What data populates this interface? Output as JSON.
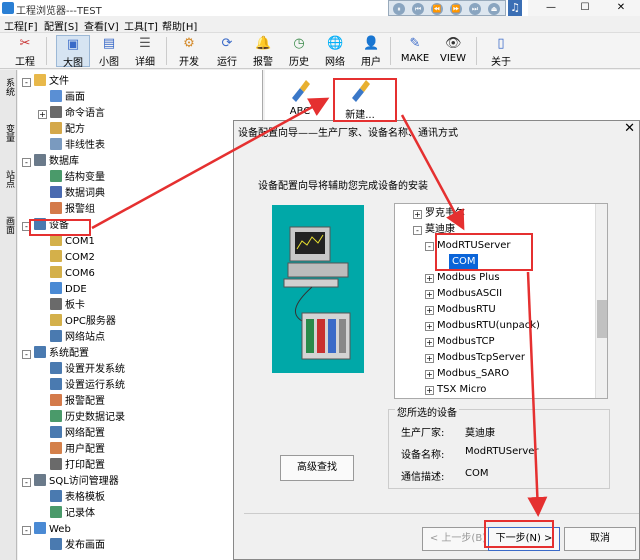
{
  "window": {
    "title": "工程浏览器---TEST",
    "controls": [
      "—",
      "☐",
      "✕"
    ]
  },
  "media": {
    "buttons": [
      "⏸",
      "⏮",
      "⏪",
      "⏩",
      "⏭",
      "⏏"
    ]
  },
  "menu": [
    "工程[F]",
    "配置[S]",
    "查看[V]",
    "工具[T]",
    "帮助[H]"
  ],
  "toolbar": [
    {
      "label": "工程",
      "icon": "wrench-icon",
      "glyph": "✂"
    },
    {
      "label": "大图",
      "icon": "large-icons-icon",
      "glyph": "▣"
    },
    {
      "label": "小图",
      "icon": "small-icons-icon",
      "glyph": "▤"
    },
    {
      "label": "详细",
      "icon": "details-icon",
      "glyph": "☰"
    },
    {
      "label": "开发",
      "icon": "develop-icon",
      "glyph": "⚙"
    },
    {
      "label": "运行",
      "icon": "run-icon",
      "glyph": "⟳"
    },
    {
      "label": "报警",
      "icon": "alarm-icon",
      "glyph": "🔔"
    },
    {
      "label": "历史",
      "icon": "history-icon",
      "glyph": "◷"
    },
    {
      "label": "网络",
      "icon": "network-icon",
      "glyph": "🌐"
    },
    {
      "label": "用户",
      "icon": "user-icon",
      "glyph": "👤"
    },
    {
      "label": "MAKE",
      "icon": "make-icon",
      "glyph": "✎"
    },
    {
      "label": "VIEW",
      "icon": "view-icon",
      "glyph": "👁"
    },
    {
      "label": "关于",
      "icon": "about-icon",
      "glyph": "▯"
    }
  ],
  "sidebar_tabs": [
    "系统",
    "变量",
    "站点",
    "画面"
  ],
  "tree": [
    {
      "label": "文件",
      "level": 0,
      "exp": "-",
      "color": "#e8b84a"
    },
    {
      "label": "画面",
      "level": 1,
      "color": "#5a8fd4"
    },
    {
      "label": "命令语言",
      "level": 1,
      "exp": "+",
      "color": "#6a6a6a"
    },
    {
      "label": "配方",
      "level": 1,
      "color": "#d4a84a"
    },
    {
      "label": "非线性表",
      "level": 1,
      "color": "#7a9abf"
    },
    {
      "label": "数据库",
      "level": 0,
      "exp": "-",
      "color": "#6a7a8a"
    },
    {
      "label": "结构变量",
      "level": 1,
      "color": "#4a9a6a"
    },
    {
      "label": "数据词典",
      "level": 1,
      "color": "#4a6ab0"
    },
    {
      "label": "报警组",
      "level": 1,
      "color": "#d47a4a"
    },
    {
      "label": "设备",
      "level": 0,
      "exp": "-",
      "color": "#4a7ab0"
    },
    {
      "label": "COM1",
      "level": 1,
      "color": "#d4b04a"
    },
    {
      "label": "COM2",
      "level": 1,
      "color": "#d4b04a"
    },
    {
      "label": "COM6",
      "level": 1,
      "color": "#d4b04a"
    },
    {
      "label": "DDE",
      "level": 1,
      "color": "#4a8ad4"
    },
    {
      "label": "板卡",
      "level": 1,
      "color": "#6a6a6a"
    },
    {
      "label": "OPC服务器",
      "level": 1,
      "color": "#d4b04a"
    },
    {
      "label": "网络站点",
      "level": 1,
      "color": "#4a7ab0"
    },
    {
      "label": "系统配置",
      "level": 0,
      "exp": "-",
      "color": "#4a7ab0"
    },
    {
      "label": "设置开发系统",
      "level": 1,
      "color": "#4a7ab0"
    },
    {
      "label": "设置运行系统",
      "level": 1,
      "color": "#4a7ab0"
    },
    {
      "label": "报警配置",
      "level": 1,
      "color": "#d47a4a"
    },
    {
      "label": "历史数据记录",
      "level": 1,
      "color": "#4a9a6a"
    },
    {
      "label": "网络配置",
      "level": 1,
      "color": "#4a7ab0"
    },
    {
      "label": "用户配置",
      "level": 1,
      "color": "#d4804a"
    },
    {
      "label": "打印配置",
      "level": 1,
      "color": "#6a6a6a"
    },
    {
      "label": "SQL访问管理器",
      "level": 0,
      "exp": "-",
      "color": "#6a7a8a"
    },
    {
      "label": "表格模板",
      "level": 1,
      "color": "#4a7ab0"
    },
    {
      "label": "记录体",
      "level": 1,
      "color": "#4a9a6a"
    },
    {
      "label": "Web",
      "level": 0,
      "exp": "-",
      "color": "#4a8ad4"
    },
    {
      "label": "发布画面",
      "level": 1,
      "color": "#4a7ab0"
    }
  ],
  "devices": [
    {
      "label": "ABC"
    },
    {
      "label": "新建..."
    }
  ],
  "dialog": {
    "title": "设备配置向导——生产厂家、设备名称、通讯方式",
    "close": "✕",
    "desc": "设备配置向导将辅助您完成设备的安装",
    "advanced": "高级查找",
    "device_tree": [
      {
        "label": "罗克韦尔",
        "level": 1,
        "exp": "+"
      },
      {
        "label": "莫迪康",
        "level": 1,
        "exp": "-"
      },
      {
        "label": "ModRTUServer",
        "level": 2,
        "exp": "-"
      },
      {
        "label": "COM",
        "level": 3,
        "selected": true
      },
      {
        "label": "Modbus Plus",
        "level": 2,
        "exp": "+"
      },
      {
        "label": "ModbusASCII",
        "level": 2,
        "exp": "+"
      },
      {
        "label": "ModbusRTU",
        "level": 2,
        "exp": "+"
      },
      {
        "label": "ModbusRTU(unpack)",
        "level": 2,
        "exp": "+"
      },
      {
        "label": "ModbusTCP",
        "level": 2,
        "exp": "+"
      },
      {
        "label": "ModbusTcpServer",
        "level": 2,
        "exp": "+"
      },
      {
        "label": "Modbus_SARO",
        "level": 2,
        "exp": "+"
      },
      {
        "label": "TSX Micro",
        "level": 2,
        "exp": "+"
      }
    ],
    "selected": {
      "legend": "您所选的设备",
      "rows": [
        {
          "k": "生产厂家:",
          "v": "莫迪康"
        },
        {
          "k": "设备名称:",
          "v": "ModRTUServer"
        },
        {
          "k": "通信描述:",
          "v": "COM"
        }
      ]
    },
    "buttons": {
      "prev": "< 上一步(B)",
      "next": "下一步(N) >",
      "cancel": "取消"
    }
  },
  "colors": {
    "accent": "#e53030",
    "selection": "#0a64d8"
  }
}
